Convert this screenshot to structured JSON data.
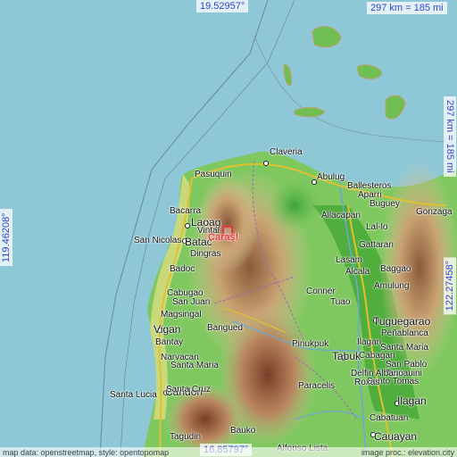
{
  "coords": {
    "top_lat": "19.52957°",
    "bottom_lat": "16.85797°",
    "left_lon": "119.46208°",
    "right_lon": "122.27458°",
    "scale_top": "297 km = 185 mi",
    "scale_right": "297 km = 185 mi"
  },
  "credits": {
    "left": "map data: openstreetmap, style: opentopomap",
    "right": "image proc.: elevation.city"
  },
  "marker": {
    "label": "Caraş!"
  },
  "places": [
    {
      "name": "Claveria"
    },
    {
      "name": "Pasuquin"
    },
    {
      "name": "Abulug"
    },
    {
      "name": "Ballesteros"
    },
    {
      "name": "Aparri"
    },
    {
      "name": "Buguey"
    },
    {
      "name": "Gonzaga"
    },
    {
      "name": "Bacarra"
    },
    {
      "name": "Laoag"
    },
    {
      "name": "Vintar"
    },
    {
      "name": "Allacapan"
    },
    {
      "name": "Lal-lo"
    },
    {
      "name": "San Nicolas"
    },
    {
      "name": "Batac"
    },
    {
      "name": "Gattaran"
    },
    {
      "name": "Dingras"
    },
    {
      "name": "Lasam"
    },
    {
      "name": "Badoc"
    },
    {
      "name": "Alcala"
    },
    {
      "name": "Baggao"
    },
    {
      "name": "Amulung"
    },
    {
      "name": "Cabugao"
    },
    {
      "name": "Conner"
    },
    {
      "name": "San Juan"
    },
    {
      "name": "Tuao"
    },
    {
      "name": "Tuguegarao"
    },
    {
      "name": "Magsingal"
    },
    {
      "name": "Peñablanca"
    },
    {
      "name": "Vigan"
    },
    {
      "name": "Bangued"
    },
    {
      "name": "Pinukpuk"
    },
    {
      "name": "Bantay"
    },
    {
      "name": "Ilagan"
    },
    {
      "name": "Tabuk"
    },
    {
      "name": "Santa Maria"
    },
    {
      "name": "Cabagan"
    },
    {
      "name": "Narvacan"
    },
    {
      "name": "San Pablo"
    },
    {
      "name": "Santa Maria"
    },
    {
      "name": "Tumauini"
    },
    {
      "name": "Candon"
    },
    {
      "name": "Delfin Albano"
    },
    {
      "name": "Santo Tomas"
    },
    {
      "name": "Roxas"
    },
    {
      "name": "Paracelis"
    },
    {
      "name": "Ilagan"
    },
    {
      "name": "Santa Lucia"
    },
    {
      "name": "Santa Cruz"
    },
    {
      "name": "Cabatuan"
    },
    {
      "name": "Cauayan"
    },
    {
      "name": "Tagudin"
    },
    {
      "name": "Bauko"
    },
    {
      "name": "Alfonso Lista"
    }
  ]
}
